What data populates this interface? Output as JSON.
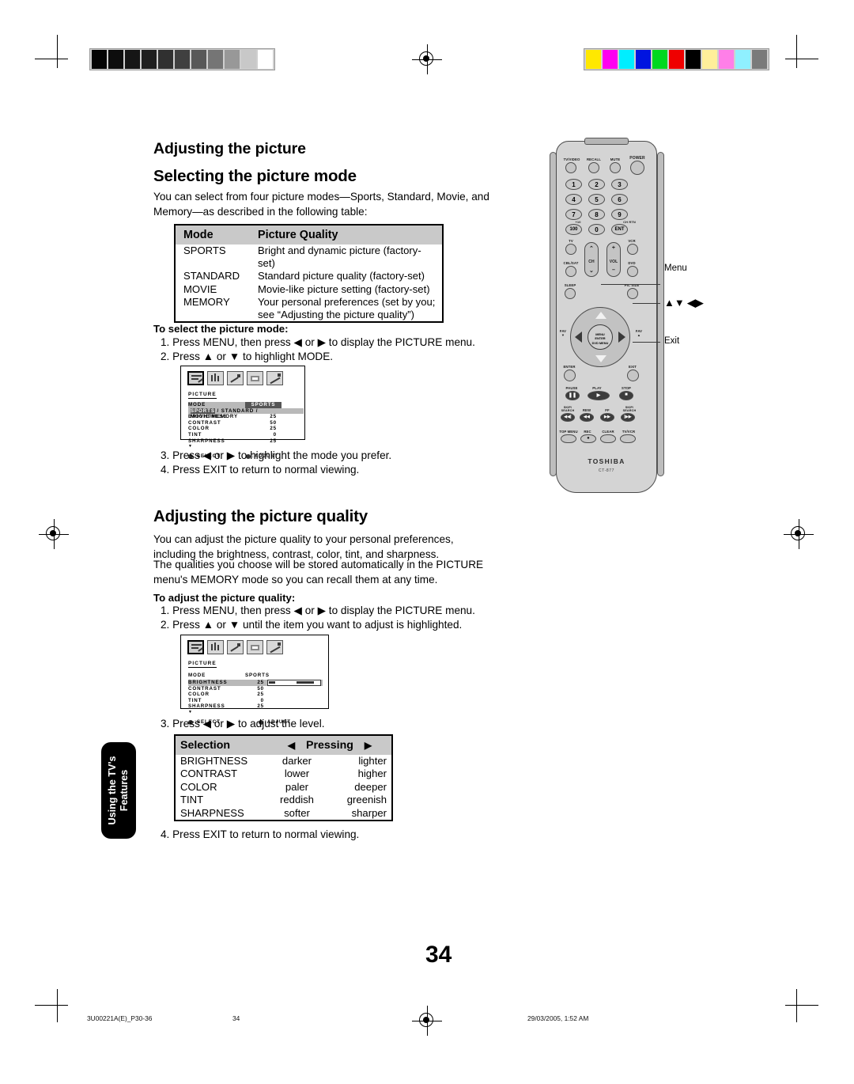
{
  "page": {
    "number": "34",
    "footer": {
      "doc_id": "3U00221A(E)_P30-36",
      "page_label": "34",
      "timestamp": "29/03/2005, 1:52 AM"
    },
    "side_tab": {
      "line1": "Using the TV's",
      "line2": "Features"
    }
  },
  "section1": {
    "title": "Adjusting the picture",
    "subtitle": "Selecting the picture mode",
    "intro": "You can select from four picture modes—Sports, Standard, Movie, and Memory—as described in the following table:",
    "table": {
      "headers": [
        "Mode",
        "Picture Quality"
      ],
      "rows": [
        {
          "mode": "SPORTS",
          "quality": "Bright and dynamic picture (factory-set)"
        },
        {
          "mode": "STANDARD",
          "quality": "Standard picture quality (factory-set)"
        },
        {
          "mode": "MOVIE",
          "quality": "Movie-like picture setting  (factory-set)"
        },
        {
          "mode": "MEMORY",
          "quality": "Your personal preferences (set by you; see “Adjusting the picture quality”)"
        }
      ]
    },
    "procedure_title": "To select the picture mode:",
    "steps_before": [
      "1. Press MENU, then press ◀ or ▶ to display the PICTURE menu.",
      "2. Press ▲ or ▼ to highlight MODE."
    ],
    "steps_after": [
      "3. Press ◀ or ▶ to highlight the mode you prefer.",
      "4. Press EXIT to return to normal viewing."
    ]
  },
  "section2": {
    "title": "Adjusting the picture quality",
    "paragraph1": "You can adjust the picture quality to your personal preferences, including the brightness, contrast, color, tint, and sharpness.",
    "paragraph2": "The qualities you choose will be stored automatically in the PICTURE menu's MEMORY mode so you can recall them at any time.",
    "procedure_title": "To adjust the picture quality:",
    "steps_before": [
      "1. Press MENU, then press ◀ or ▶ to display the PICTURE menu.",
      "2. Press ▲ or ▼ until the item you want to adjust is highlighted."
    ],
    "step3": "3. Press ◀ or ▶ to adjust the level.",
    "step4": "4. Press EXIT to return to normal viewing.",
    "table": {
      "headers": {
        "selection": "Selection",
        "pressing": "Pressing",
        "left_arrow": "◀",
        "right_arrow": "▶"
      },
      "rows": [
        {
          "selection": "BRIGHTNESS",
          "left": "darker",
          "right": "lighter"
        },
        {
          "selection": "CONTRAST",
          "left": "lower",
          "right": "higher"
        },
        {
          "selection": "COLOR",
          "left": "paler",
          "right": "deeper"
        },
        {
          "selection": "TINT",
          "left": "reddish",
          "right": "greenish"
        },
        {
          "selection": "SHARPNESS",
          "left": "softer",
          "right": "sharper"
        }
      ]
    }
  },
  "osd1": {
    "menu_title": "PICTURE",
    "mode_label": "MODE",
    "mode_value": "SPORTS",
    "mode_options": "SPORTS / STANDARD / MOVIE/MEMORY",
    "rows": [
      {
        "label": "BRIGHTNESS",
        "value": "25"
      },
      {
        "label": "CONTRAST",
        "value": "50"
      },
      {
        "label": "COLOR",
        "value": "25"
      },
      {
        "label": "TINT",
        "value": "0"
      },
      {
        "label": "SHARPNESS",
        "value": "25"
      }
    ],
    "footer_select": ":SELECT",
    "footer_adjust": ":ADJUST",
    "more_arrow": "▼"
  },
  "osd2": {
    "menu_title": "PICTURE",
    "mode_label": "MODE",
    "mode_value": "SPORTS",
    "rows": [
      {
        "label": "BRIGHTNESS",
        "value": "25",
        "highlighted": true
      },
      {
        "label": "CONTRAST",
        "value": "50",
        "highlighted": false
      },
      {
        "label": "COLOR",
        "value": "25",
        "highlighted": false
      },
      {
        "label": "TINT",
        "value": "0",
        "highlighted": false
      },
      {
        "label": "SHARPNESS",
        "value": "25",
        "highlighted": false
      }
    ],
    "footer_select": ":SELECT",
    "footer_adjust": ":ADJUST",
    "more_arrow": "▼"
  },
  "remote": {
    "brand": "TOSHIBA",
    "model": "CT-877",
    "top_buttons": [
      "TV/VIDEO",
      "RECALL",
      "MUTE",
      "POWER"
    ],
    "keypad": [
      "1",
      "2",
      "3",
      "4",
      "5",
      "6",
      "7",
      "8",
      "9",
      "100",
      "0",
      "ENT"
    ],
    "keypad_sup_left": "+10",
    "keypad_sup_right": "CH RTN",
    "device_buttons": [
      "TV",
      "VCR",
      "CBL/SAT",
      "DVD"
    ],
    "rocker_labels": {
      "ch": "CH",
      "vol": "VOL",
      "plus": "+",
      "minus": "–"
    },
    "mid_buttons": [
      "SLEEP",
      "PIC SIZE"
    ],
    "fav_left": "FAV\n▼",
    "fav_right": "FAV\n▲",
    "center": [
      "MENU",
      "ENTER",
      "DVD MENU"
    ],
    "enter_exit": [
      "ENTER",
      "EXIT"
    ],
    "transport": [
      "PAUSE",
      "PLAY",
      "STOP"
    ],
    "transport2": [
      "SKIP/ SEARCH",
      "REW",
      "FF",
      "SKIP/ SEARCH"
    ],
    "bottom": [
      "TOP MENU",
      "REC",
      "CLEAR",
      "TV/VCR"
    ],
    "callouts": [
      {
        "label": "Menu"
      },
      {
        "label": "▲▼ ◀▶"
      },
      {
        "label": "Exit"
      }
    ]
  },
  "registration": {
    "gray_bars": [
      "#050505",
      "#0d0d0d",
      "#161616",
      "#1f1f1f",
      "#303030",
      "#404040",
      "#585858",
      "#757575",
      "#989898",
      "#c8c8c8",
      "#ffffff"
    ],
    "color_bars": [
      "#ffe800",
      "#ff00f0",
      "#00eeff",
      "#0014e0",
      "#00d820",
      "#ef0000",
      "#000000",
      "#ffef9a",
      "#ff7fe8",
      "#8ff0ff",
      "#7a7a7a"
    ]
  }
}
